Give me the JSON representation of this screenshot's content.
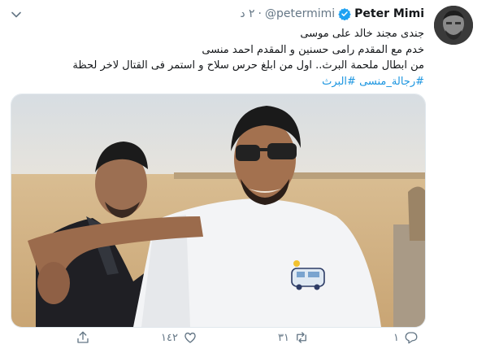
{
  "tweet": {
    "author_name": "Peter Mimi",
    "handle": "@petermimi",
    "time": "٢ د",
    "lines": [
      "جندى مجند خالد على موسى",
      "خدم مع المقدم رامى حسنين و  المقدم احمد منسى",
      "من ابطال ملحمة البرث..  اول من ابلغ  حرس سلاح و استمر فى القتال لاخر لحظة"
    ],
    "hashtags": [
      "#رجالة_منسى",
      "#البرث"
    ]
  },
  "actions": {
    "reply_count": "١",
    "retweet_count": "٣١",
    "like_count": "١٤٢"
  },
  "colors": {
    "accent": "#1da1f2",
    "muted": "#657786",
    "text": "#14171a"
  },
  "icons": [
    "chevron-down-icon",
    "verified-badge-icon",
    "reply-icon",
    "retweet-icon",
    "like-icon",
    "share-icon"
  ]
}
